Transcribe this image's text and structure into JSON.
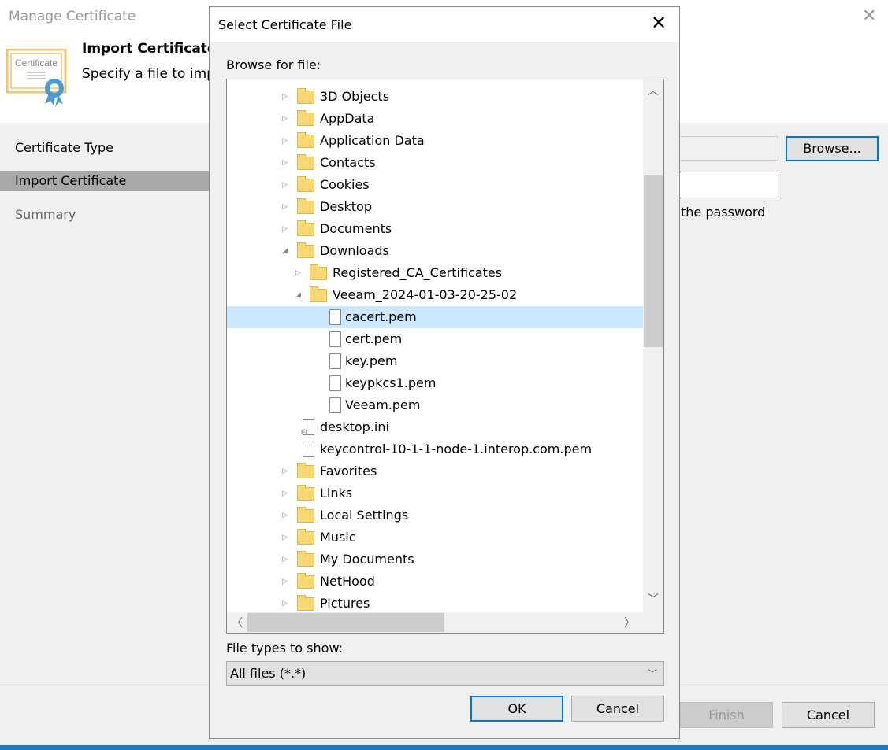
{
  "main": {
    "title": "Manage Certificate",
    "header_title": "Import Certificate",
    "header_subtitle": "Specify a file to impo",
    "nav": [
      {
        "label": "Certificate Type"
      },
      {
        "label": "Import Certificate"
      },
      {
        "label": "Summary"
      }
    ],
    "browse_label": "Browse...",
    "password_text": "the password",
    "finish_label": "Finish",
    "cancel_label": "Cancel"
  },
  "dialog": {
    "title": "Select Certificate File",
    "browse_for_file": "Browse for file:",
    "tree": [
      {
        "label": "3D Objects",
        "type": "folder",
        "level": 0,
        "expander": "collapsed"
      },
      {
        "label": "AppData",
        "type": "folder",
        "level": 0,
        "expander": "collapsed"
      },
      {
        "label": "Application Data",
        "type": "folder",
        "level": 0,
        "expander": "collapsed"
      },
      {
        "label": "Contacts",
        "type": "folder",
        "level": 0,
        "expander": "collapsed"
      },
      {
        "label": "Cookies",
        "type": "folder",
        "level": 0,
        "expander": "collapsed"
      },
      {
        "label": "Desktop",
        "type": "folder",
        "level": 0,
        "expander": "collapsed"
      },
      {
        "label": "Documents",
        "type": "folder",
        "level": 0,
        "expander": "collapsed"
      },
      {
        "label": "Downloads",
        "type": "folder",
        "level": 0,
        "expander": "expanded"
      },
      {
        "label": "Registered_CA_Certificates",
        "type": "folder",
        "level": 1,
        "expander": "collapsed"
      },
      {
        "label": "Veeam_2024-01-03-20-25-02",
        "type": "folder",
        "level": 1,
        "expander": "expanded"
      },
      {
        "label": "cacert.pem",
        "type": "file",
        "level": 2,
        "selected": true
      },
      {
        "label": "cert.pem",
        "type": "file",
        "level": 2
      },
      {
        "label": "key.pem",
        "type": "file",
        "level": 2
      },
      {
        "label": "keypkcs1.pem",
        "type": "file",
        "level": 2
      },
      {
        "label": "Veeam.pem",
        "type": "file",
        "level": 2
      },
      {
        "label": "desktop.ini",
        "type": "settings-file",
        "level": 1
      },
      {
        "label": "keycontrol-10-1-1-node-1.interop.com.pem",
        "type": "file",
        "level": 1
      },
      {
        "label": "Favorites",
        "type": "folder",
        "level": 0,
        "expander": "collapsed"
      },
      {
        "label": "Links",
        "type": "folder",
        "level": 0,
        "expander": "collapsed"
      },
      {
        "label": "Local Settings",
        "type": "folder",
        "level": 0,
        "expander": "collapsed"
      },
      {
        "label": "Music",
        "type": "folder",
        "level": 0,
        "expander": "collapsed"
      },
      {
        "label": "My Documents",
        "type": "folder",
        "level": 0,
        "expander": "collapsed"
      },
      {
        "label": "NetHood",
        "type": "folder",
        "level": 0,
        "expander": "collapsed"
      },
      {
        "label": "Pictures",
        "type": "folder",
        "level": 0,
        "expander": "collapsed"
      }
    ],
    "file_types_label": "File types to show:",
    "file_types_value": "All files (*.*)",
    "ok_label": "OK",
    "cancel_label": "Cancel"
  },
  "colors": {
    "selection": "#cce8ff",
    "accent": "#0078d7",
    "folder": "#f8d775"
  }
}
